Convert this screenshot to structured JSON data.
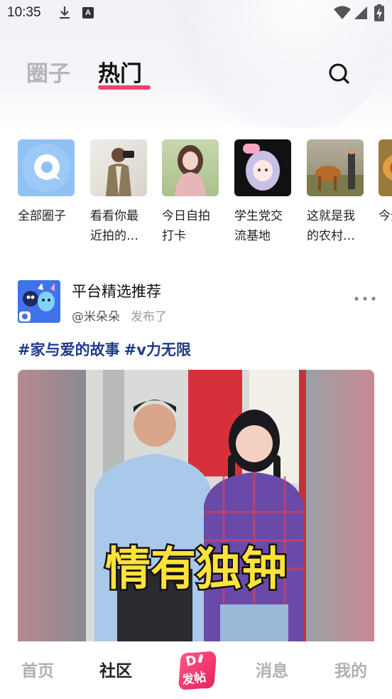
{
  "status_bar": {
    "time": "10:35",
    "input_badge": "A"
  },
  "header": {
    "tabs": [
      {
        "label": "圈子",
        "active": false
      },
      {
        "label": "热门",
        "active": true
      }
    ],
    "accent_color": "#f2416b"
  },
  "circles": [
    {
      "label": "全部圈子",
      "icon": "chat-bubble-icon"
    },
    {
      "label": "看看你最近拍的…"
    },
    {
      "label": "今日自拍打卡"
    },
    {
      "label": "学生党交流基地"
    },
    {
      "label": "这就是我的农村…"
    },
    {
      "label": "今分"
    }
  ],
  "post": {
    "author": "平台精选推荐",
    "handle": "@米朵朵",
    "action": "发布了",
    "tags": [
      "#家与爱的故事",
      "#v力无限"
    ],
    "image_caption": "情有独钟",
    "tag_color": "#1e3c8c"
  },
  "bottom_nav": {
    "items": [
      {
        "label": "首页",
        "active": false
      },
      {
        "label": "社区",
        "active": true
      },
      {
        "label": "消息",
        "active": false
      },
      {
        "label": "我的",
        "active": false
      }
    ],
    "post_button_label": "发帖"
  }
}
